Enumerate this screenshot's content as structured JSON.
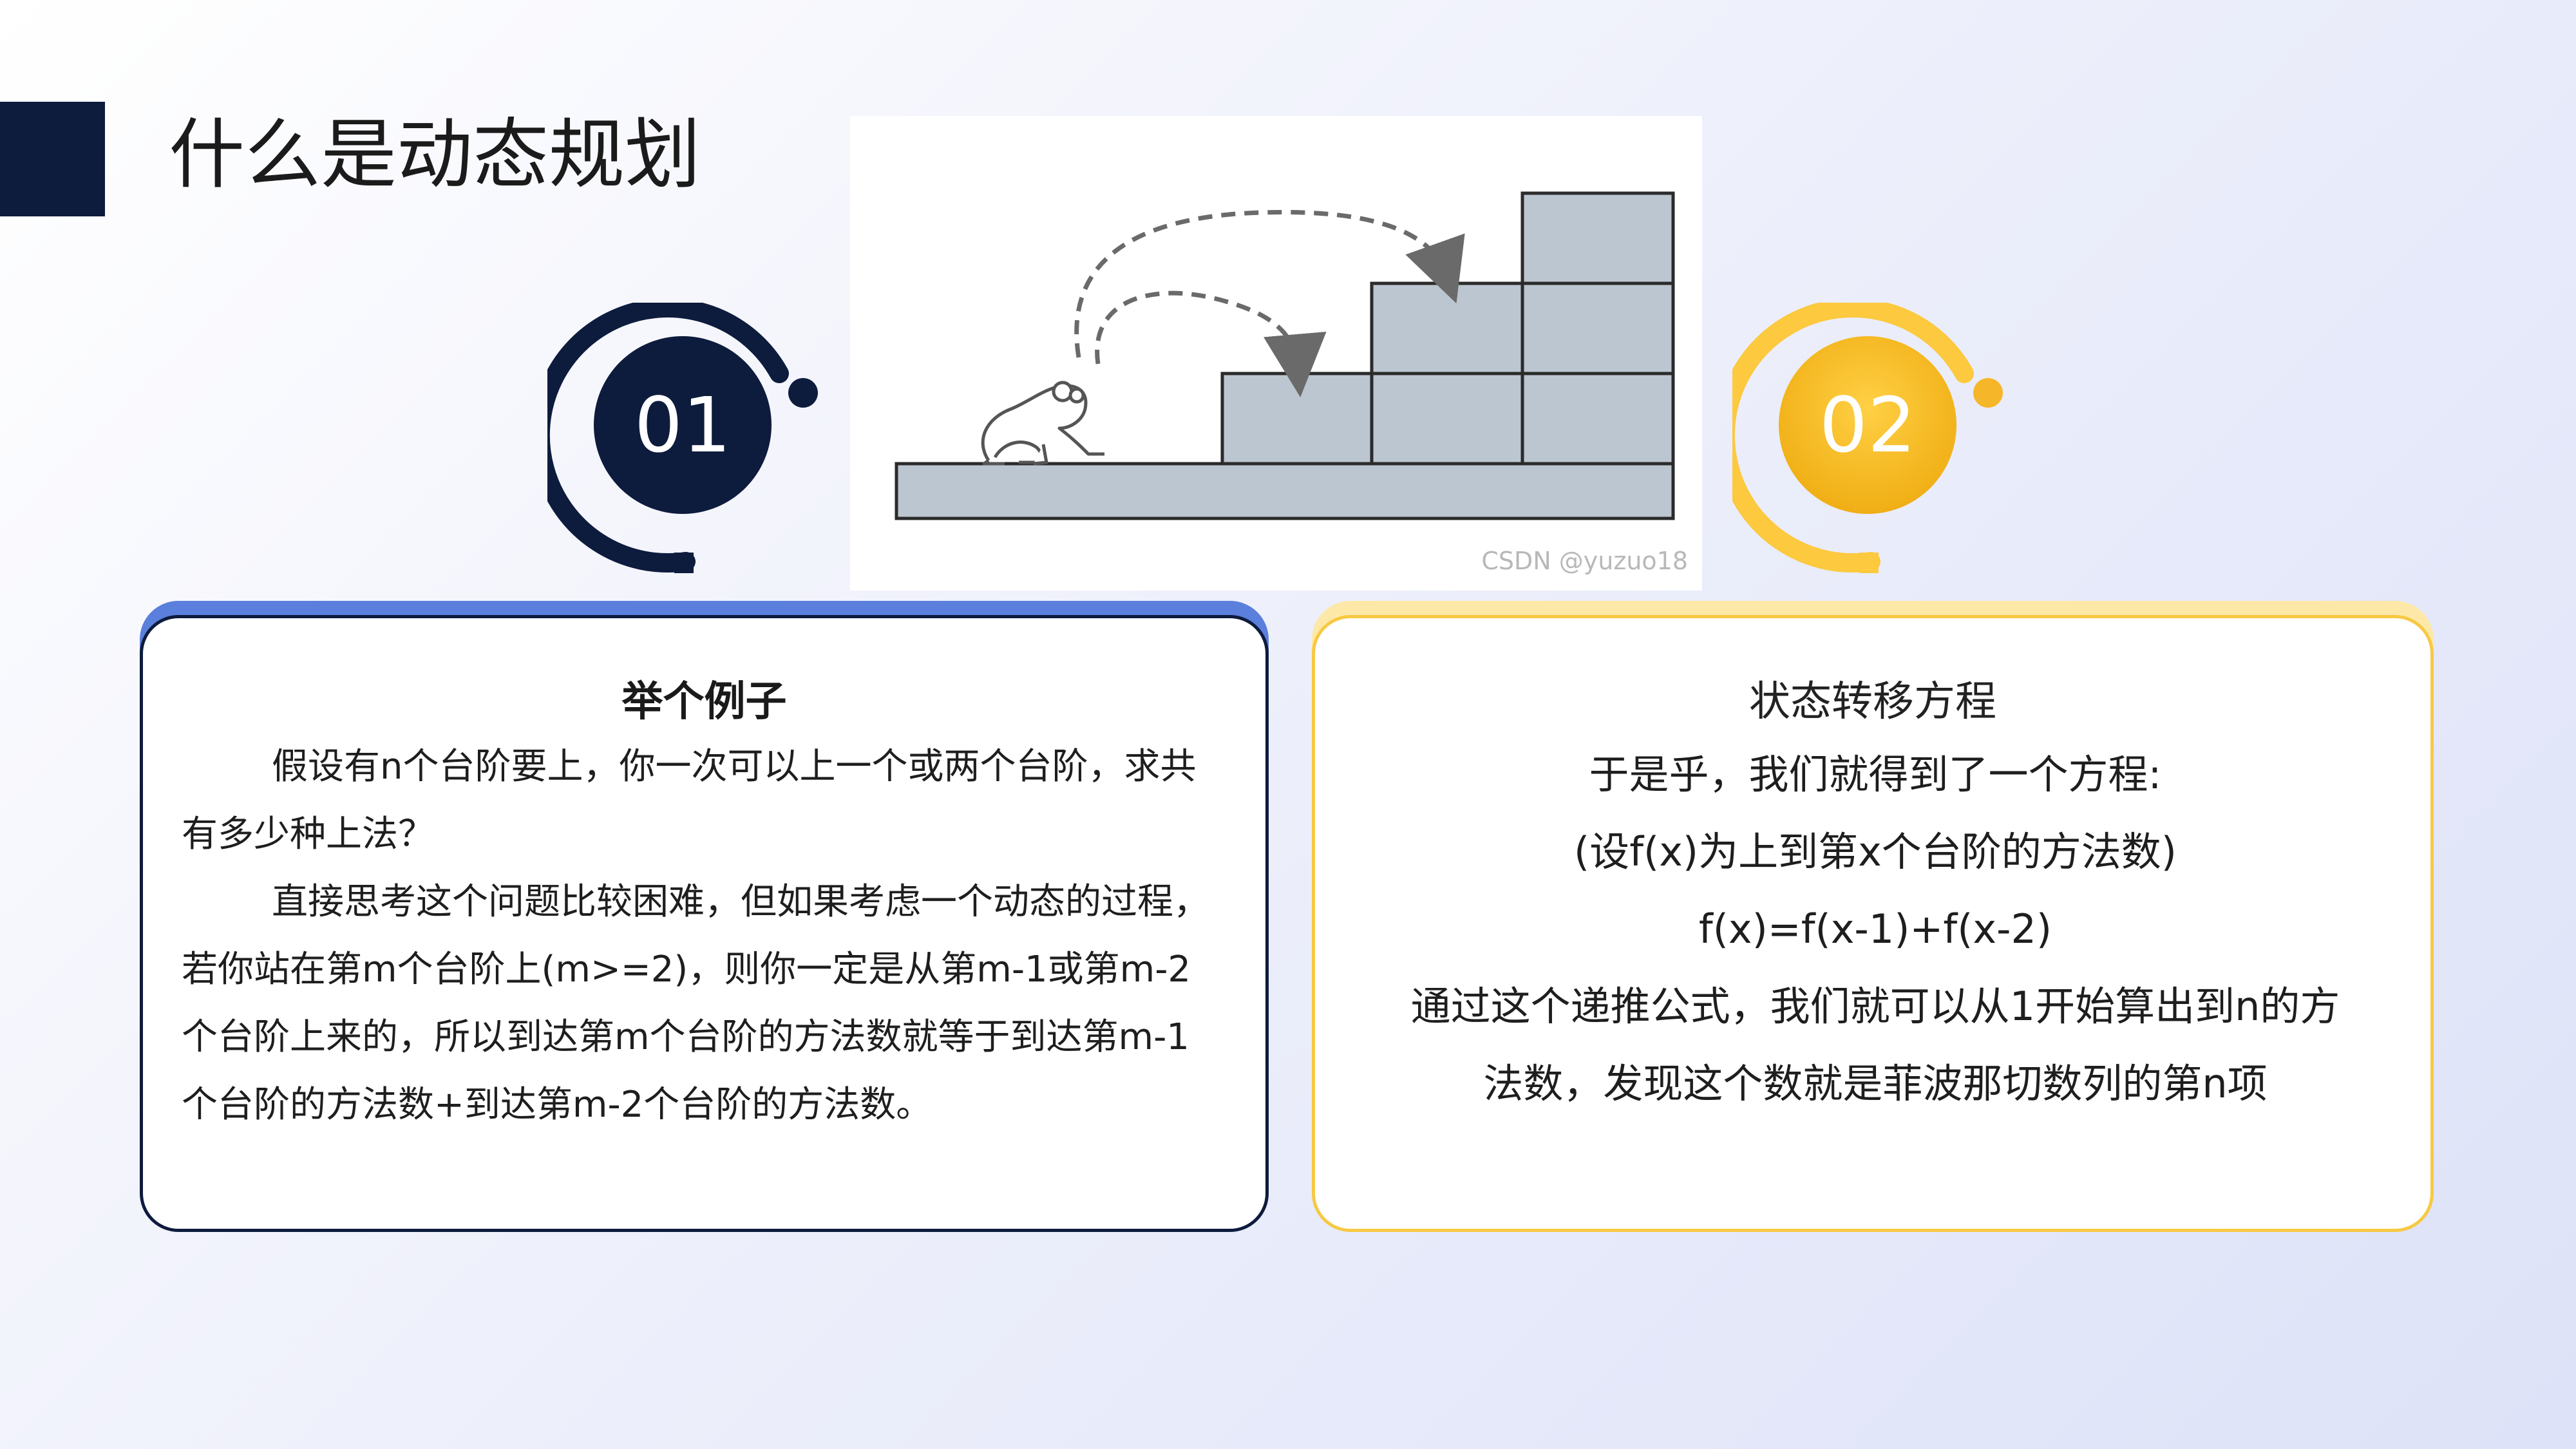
{
  "page": {
    "title": "什么是动态规划"
  },
  "illustration": {
    "watermark": "CSDN @yuzuo18"
  },
  "badges": [
    {
      "number": "01",
      "color": "#0d1b3d"
    },
    {
      "number": "02",
      "color": "#f2b824"
    }
  ],
  "cards": {
    "example": {
      "heading": "举个例子",
      "paragraphs": [
        "假设有n个台阶要上，你一次可以上一个或两个台阶，求共有多少种上法？",
        "直接思考这个问题比较困难，但如果考虑一个动态的过程，若你站在第m个台阶上(m>=2)，则你一定是从第m-1或第m-2个台阶上来的，所以到达第m个台阶的方法数就等于到达第m-1个台阶的方法数+到达第m-2个台阶的方法数。"
      ]
    },
    "transition": {
      "heading": "状态转移方程",
      "lines": [
        "于是乎，我们就得到了一个方程:",
        "(设f(x)为上到第x个台阶的方法数)",
        "f(x)=f(x-1)+f(x-2)",
        "通过这个递推公式，我们就可以从1开始算出到n的方",
        "法数，发现这个数就是菲波那切数列的第n项"
      ]
    }
  },
  "colors": {
    "navy": "#0d1b3d",
    "blue_accent": "#5b7fdc",
    "gold": "#f2b824",
    "gold_light": "#fde8a8",
    "stair_fill": "#bcc6d0"
  }
}
